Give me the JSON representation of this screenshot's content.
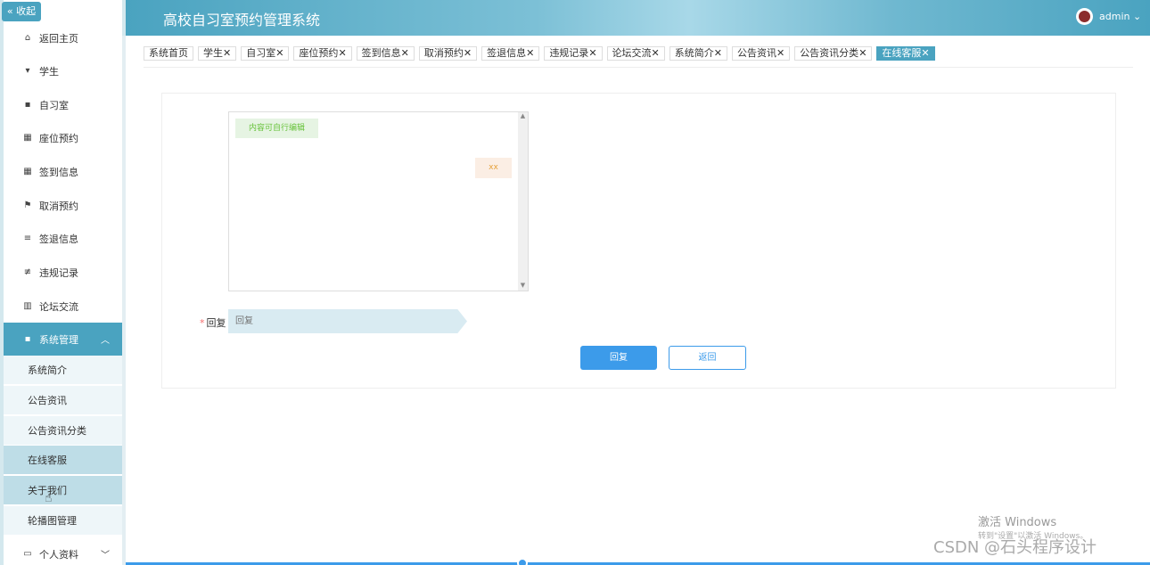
{
  "sidebar": {
    "collapse_label": "« 收起",
    "items": [
      {
        "label": "返回主页",
        "icon": "home-icon"
      },
      {
        "label": "学生",
        "icon": "user-icon"
      },
      {
        "label": "自习室",
        "icon": "monitor-icon"
      },
      {
        "label": "座位预约",
        "icon": "grid-icon"
      },
      {
        "label": "签到信息",
        "icon": "grid-icon"
      },
      {
        "label": "取消预约",
        "icon": "flag-icon"
      },
      {
        "label": "签退信息",
        "icon": "list-icon"
      },
      {
        "label": "违规记录",
        "icon": "sliders-icon"
      },
      {
        "label": "论坛交流",
        "icon": "chart-icon"
      },
      {
        "label": "系统管理",
        "icon": "settings-icon"
      }
    ],
    "sub_items": [
      "系统简介",
      "公告资讯",
      "公告资讯分类",
      "在线客服",
      "关于我们",
      "轮播图管理"
    ],
    "profile_label": "个人资料"
  },
  "header": {
    "title": "高校自习室预约管理系统",
    "user": "admin"
  },
  "tabs": [
    {
      "label": "系统首页",
      "closable": false
    },
    {
      "label": "学生",
      "closable": true
    },
    {
      "label": "自习室",
      "closable": true
    },
    {
      "label": "座位预约",
      "closable": true
    },
    {
      "label": "签到信息",
      "closable": true
    },
    {
      "label": "取消预约",
      "closable": true
    },
    {
      "label": "签退信息",
      "closable": true
    },
    {
      "label": "违规记录",
      "closable": true
    },
    {
      "label": "论坛交流",
      "closable": true
    },
    {
      "label": "系统简介",
      "closable": true
    },
    {
      "label": "公告资讯",
      "closable": true
    },
    {
      "label": "公告资讯分类",
      "closable": true
    },
    {
      "label": "在线客服",
      "closable": true,
      "active": true
    }
  ],
  "chat": {
    "left_message": "内容可自行编辑",
    "right_message": "xx"
  },
  "form": {
    "reply_label": "回复",
    "reply_placeholder": "回复",
    "submit_label": "回复",
    "back_label": "返回"
  },
  "watermark": {
    "windows": "激活 Windows",
    "windows_sub": "转到\"设置\"以激活 Windows。",
    "csdn": "CSDN @石头程序设计"
  }
}
